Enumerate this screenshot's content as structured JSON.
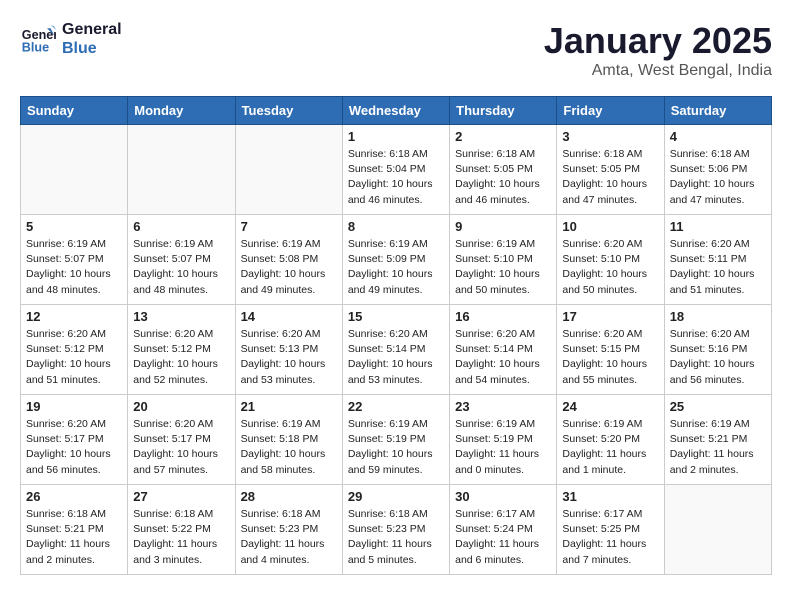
{
  "header": {
    "logo_line1": "General",
    "logo_line2": "Blue",
    "title": "January 2025",
    "subtitle": "Amta, West Bengal, India"
  },
  "days_of_week": [
    "Sunday",
    "Monday",
    "Tuesday",
    "Wednesday",
    "Thursday",
    "Friday",
    "Saturday"
  ],
  "weeks": [
    [
      {
        "day": null
      },
      {
        "day": null
      },
      {
        "day": null
      },
      {
        "day": "1",
        "sunrise": "Sunrise: 6:18 AM",
        "sunset": "Sunset: 5:04 PM",
        "daylight": "Daylight: 10 hours and 46 minutes."
      },
      {
        "day": "2",
        "sunrise": "Sunrise: 6:18 AM",
        "sunset": "Sunset: 5:05 PM",
        "daylight": "Daylight: 10 hours and 46 minutes."
      },
      {
        "day": "3",
        "sunrise": "Sunrise: 6:18 AM",
        "sunset": "Sunset: 5:05 PM",
        "daylight": "Daylight: 10 hours and 47 minutes."
      },
      {
        "day": "4",
        "sunrise": "Sunrise: 6:18 AM",
        "sunset": "Sunset: 5:06 PM",
        "daylight": "Daylight: 10 hours and 47 minutes."
      }
    ],
    [
      {
        "day": "5",
        "sunrise": "Sunrise: 6:19 AM",
        "sunset": "Sunset: 5:07 PM",
        "daylight": "Daylight: 10 hours and 48 minutes."
      },
      {
        "day": "6",
        "sunrise": "Sunrise: 6:19 AM",
        "sunset": "Sunset: 5:07 PM",
        "daylight": "Daylight: 10 hours and 48 minutes."
      },
      {
        "day": "7",
        "sunrise": "Sunrise: 6:19 AM",
        "sunset": "Sunset: 5:08 PM",
        "daylight": "Daylight: 10 hours and 49 minutes."
      },
      {
        "day": "8",
        "sunrise": "Sunrise: 6:19 AM",
        "sunset": "Sunset: 5:09 PM",
        "daylight": "Daylight: 10 hours and 49 minutes."
      },
      {
        "day": "9",
        "sunrise": "Sunrise: 6:19 AM",
        "sunset": "Sunset: 5:10 PM",
        "daylight": "Daylight: 10 hours and 50 minutes."
      },
      {
        "day": "10",
        "sunrise": "Sunrise: 6:20 AM",
        "sunset": "Sunset: 5:10 PM",
        "daylight": "Daylight: 10 hours and 50 minutes."
      },
      {
        "day": "11",
        "sunrise": "Sunrise: 6:20 AM",
        "sunset": "Sunset: 5:11 PM",
        "daylight": "Daylight: 10 hours and 51 minutes."
      }
    ],
    [
      {
        "day": "12",
        "sunrise": "Sunrise: 6:20 AM",
        "sunset": "Sunset: 5:12 PM",
        "daylight": "Daylight: 10 hours and 51 minutes."
      },
      {
        "day": "13",
        "sunrise": "Sunrise: 6:20 AM",
        "sunset": "Sunset: 5:12 PM",
        "daylight": "Daylight: 10 hours and 52 minutes."
      },
      {
        "day": "14",
        "sunrise": "Sunrise: 6:20 AM",
        "sunset": "Sunset: 5:13 PM",
        "daylight": "Daylight: 10 hours and 53 minutes."
      },
      {
        "day": "15",
        "sunrise": "Sunrise: 6:20 AM",
        "sunset": "Sunset: 5:14 PM",
        "daylight": "Daylight: 10 hours and 53 minutes."
      },
      {
        "day": "16",
        "sunrise": "Sunrise: 6:20 AM",
        "sunset": "Sunset: 5:14 PM",
        "daylight": "Daylight: 10 hours and 54 minutes."
      },
      {
        "day": "17",
        "sunrise": "Sunrise: 6:20 AM",
        "sunset": "Sunset: 5:15 PM",
        "daylight": "Daylight: 10 hours and 55 minutes."
      },
      {
        "day": "18",
        "sunrise": "Sunrise: 6:20 AM",
        "sunset": "Sunset: 5:16 PM",
        "daylight": "Daylight: 10 hours and 56 minutes."
      }
    ],
    [
      {
        "day": "19",
        "sunrise": "Sunrise: 6:20 AM",
        "sunset": "Sunset: 5:17 PM",
        "daylight": "Daylight: 10 hours and 56 minutes."
      },
      {
        "day": "20",
        "sunrise": "Sunrise: 6:20 AM",
        "sunset": "Sunset: 5:17 PM",
        "daylight": "Daylight: 10 hours and 57 minutes."
      },
      {
        "day": "21",
        "sunrise": "Sunrise: 6:19 AM",
        "sunset": "Sunset: 5:18 PM",
        "daylight": "Daylight: 10 hours and 58 minutes."
      },
      {
        "day": "22",
        "sunrise": "Sunrise: 6:19 AM",
        "sunset": "Sunset: 5:19 PM",
        "daylight": "Daylight: 10 hours and 59 minutes."
      },
      {
        "day": "23",
        "sunrise": "Sunrise: 6:19 AM",
        "sunset": "Sunset: 5:19 PM",
        "daylight": "Daylight: 11 hours and 0 minutes."
      },
      {
        "day": "24",
        "sunrise": "Sunrise: 6:19 AM",
        "sunset": "Sunset: 5:20 PM",
        "daylight": "Daylight: 11 hours and 1 minute."
      },
      {
        "day": "25",
        "sunrise": "Sunrise: 6:19 AM",
        "sunset": "Sunset: 5:21 PM",
        "daylight": "Daylight: 11 hours and 2 minutes."
      }
    ],
    [
      {
        "day": "26",
        "sunrise": "Sunrise: 6:18 AM",
        "sunset": "Sunset: 5:21 PM",
        "daylight": "Daylight: 11 hours and 2 minutes."
      },
      {
        "day": "27",
        "sunrise": "Sunrise: 6:18 AM",
        "sunset": "Sunset: 5:22 PM",
        "daylight": "Daylight: 11 hours and 3 minutes."
      },
      {
        "day": "28",
        "sunrise": "Sunrise: 6:18 AM",
        "sunset": "Sunset: 5:23 PM",
        "daylight": "Daylight: 11 hours and 4 minutes."
      },
      {
        "day": "29",
        "sunrise": "Sunrise: 6:18 AM",
        "sunset": "Sunset: 5:23 PM",
        "daylight": "Daylight: 11 hours and 5 minutes."
      },
      {
        "day": "30",
        "sunrise": "Sunrise: 6:17 AM",
        "sunset": "Sunset: 5:24 PM",
        "daylight": "Daylight: 11 hours and 6 minutes."
      },
      {
        "day": "31",
        "sunrise": "Sunrise: 6:17 AM",
        "sunset": "Sunset: 5:25 PM",
        "daylight": "Daylight: 11 hours and 7 minutes."
      },
      {
        "day": null
      }
    ]
  ]
}
